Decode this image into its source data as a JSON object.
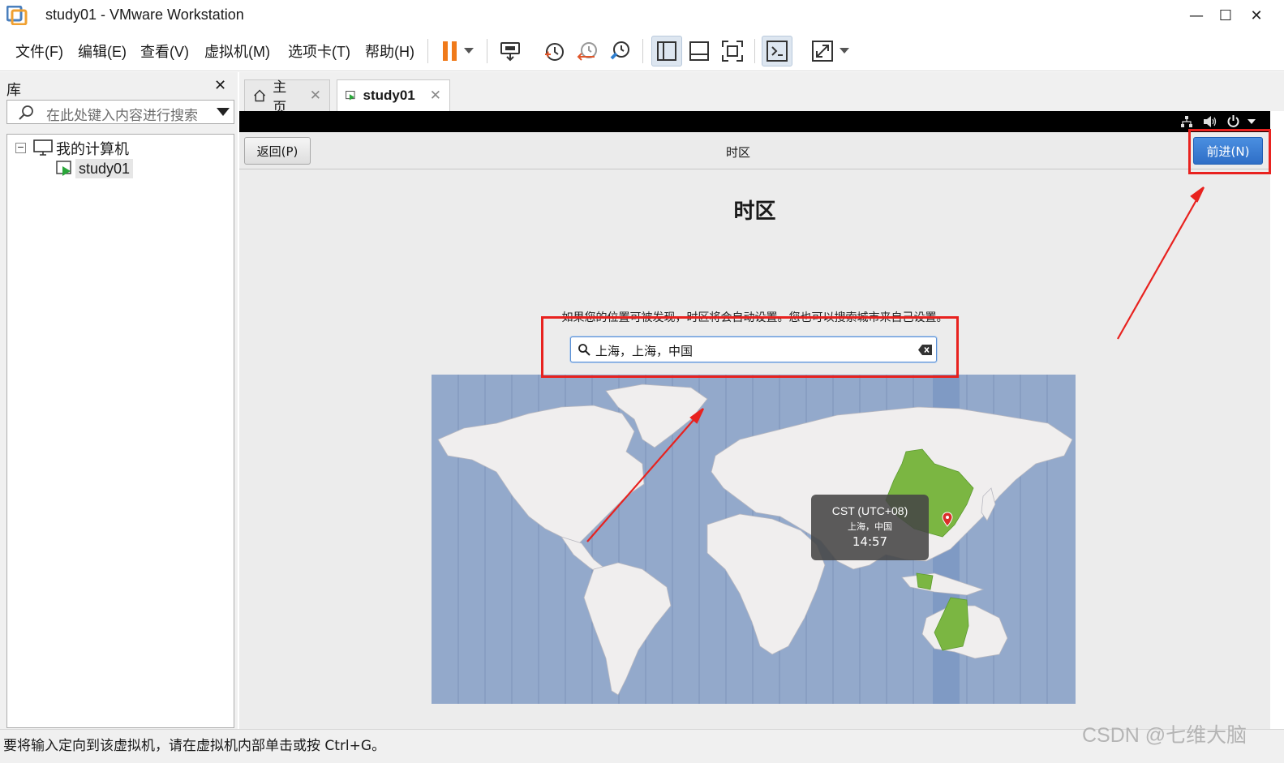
{
  "window": {
    "title": "study01 - VMware Workstation",
    "controls": [
      "—",
      "☐",
      "✕"
    ]
  },
  "menu": {
    "items": [
      "文件(F)",
      "编辑(E)",
      "查看(V)",
      "虚拟机(M)",
      "选项卡(T)",
      "帮助(H)"
    ]
  },
  "toolbar": {
    "icons": [
      "pause-icon",
      "dropdown-icon",
      "send-ctrl-alt-del-icon",
      "snapshot-icon",
      "revert-snapshot-icon",
      "snapshot-manager-icon",
      "library-view-icon",
      "thumbnail-view-icon",
      "fullscreen-icon",
      "console-view-icon",
      "stretch-icon",
      "dropdown-icon"
    ]
  },
  "library": {
    "title": "库",
    "close": "✕",
    "search_placeholder": "在此处键入内容进行搜索",
    "tree": {
      "root": "我的计算机",
      "expand": "−",
      "vm": "study01"
    }
  },
  "tabs": [
    {
      "label": "主页",
      "close": "✕",
      "icon": "home-icon"
    },
    {
      "label": "study01",
      "close": "✕",
      "icon": "vm-icon"
    }
  ],
  "installer": {
    "back_label": "返回(P)",
    "header_title": "时区",
    "next_label": "前进(N)",
    "page_title": "时区",
    "hint": "如果您的位置可被发现，时区将会自动设置。您也可以搜索城市来自己设置。",
    "search_value": "上海，上海，中国",
    "tooltip": {
      "zone": "CST (UTC+08)",
      "city": "上海，中国",
      "time": "14:57"
    },
    "system_icons": [
      "network-icon",
      "volume-icon",
      "power-icon",
      "chevron-down-icon"
    ]
  },
  "status": {
    "text": "要将输入定向到该虚拟机，请在虚拟机内部单击或按 Ctrl+G。"
  },
  "watermark": "CSDN @七维大脑",
  "colors": {
    "annotation": "#e8221f",
    "next_button": "#3a7fd5",
    "map_ocean": "#93a9cb",
    "map_land": "#f0eeee",
    "selected_zone": "#7bb642"
  }
}
